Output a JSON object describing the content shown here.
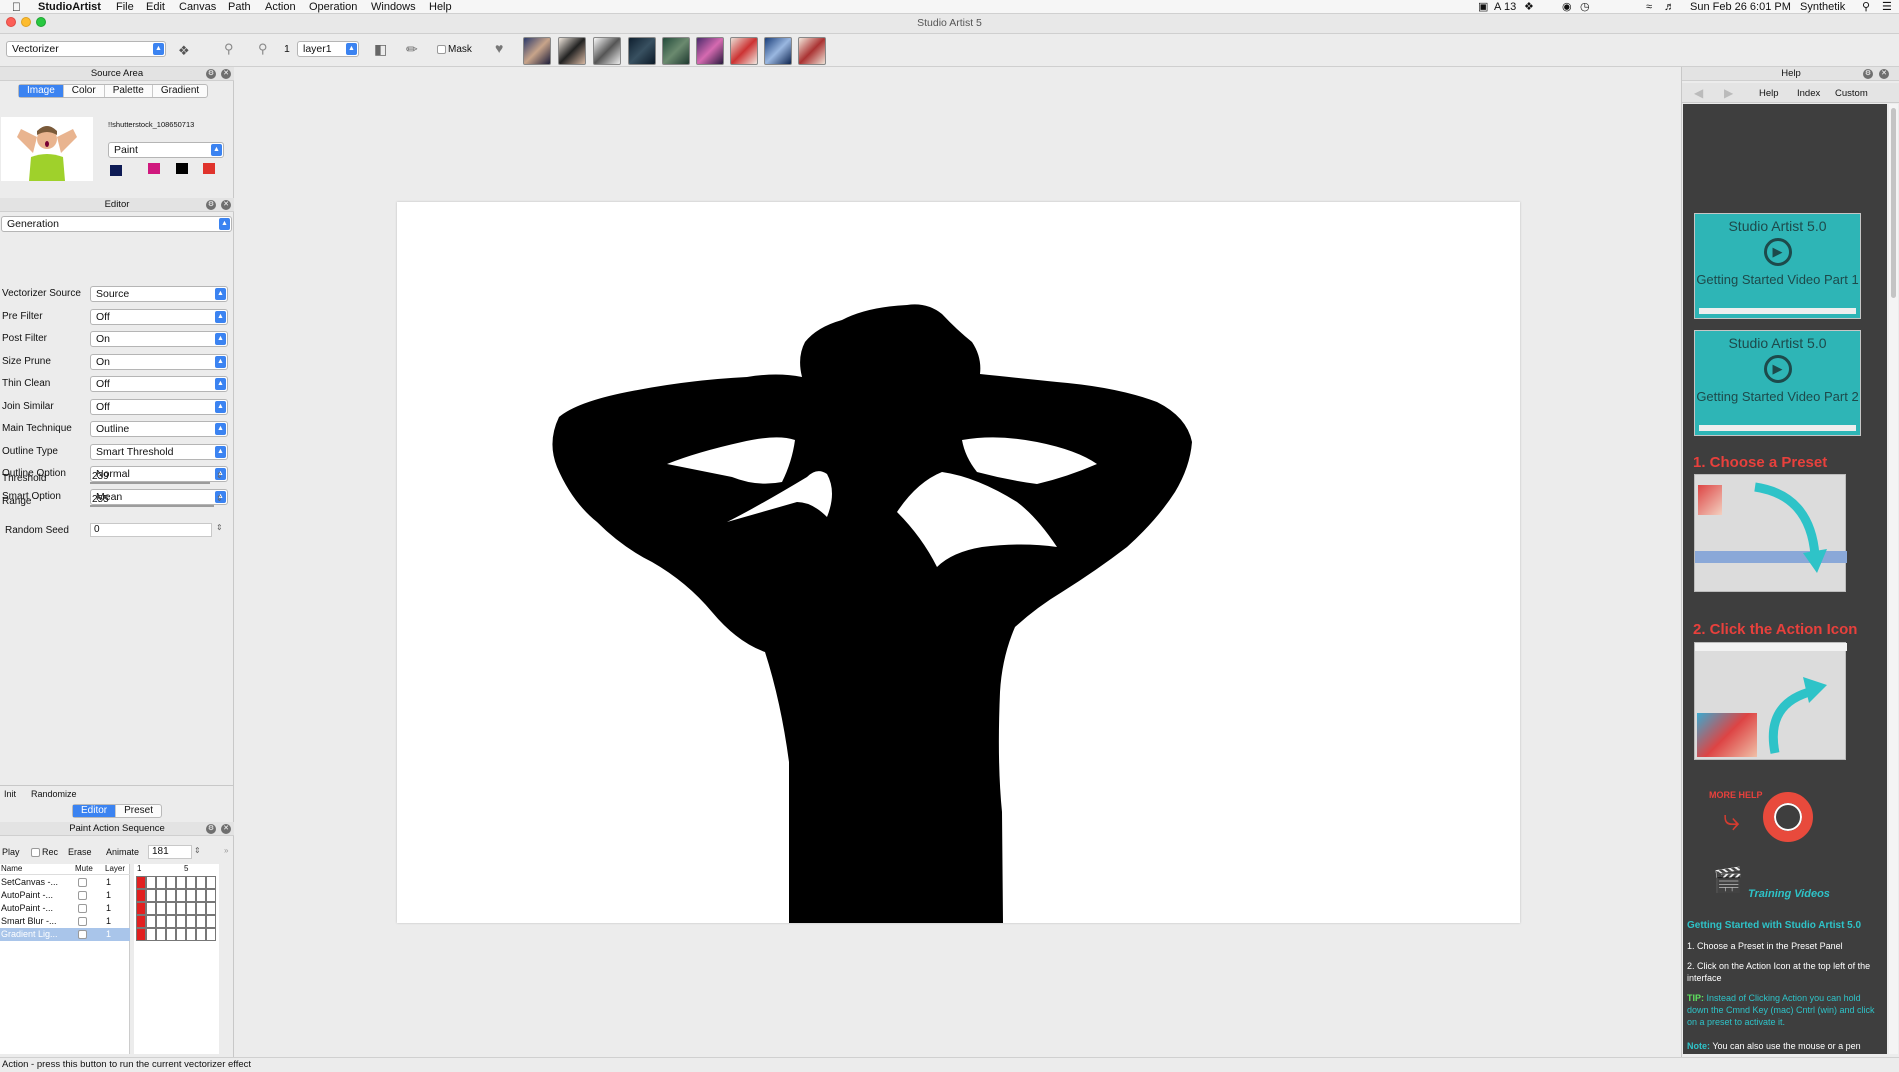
{
  "menubar": {
    "apple": "",
    "app": "StudioArtist",
    "items": [
      "File",
      "Edit",
      "Canvas",
      "Path",
      "Action",
      "Operation",
      "Windows",
      "Help"
    ],
    "right": {
      "adobe_count": "13",
      "datetime": "Sun Feb 26  6:01 PM",
      "user": "Synthetik"
    }
  },
  "window": {
    "title": "Studio Artist 5"
  },
  "toolbar": {
    "op_select": "Vectorizer",
    "layer_num": "1",
    "layer_select": "layer1",
    "mask_label": "Mask"
  },
  "source_area": {
    "title": "Source Area",
    "tabs": [
      "Image",
      "Color",
      "Palette",
      "Gradient"
    ],
    "filename": "!!shutterstock_108650713",
    "mode": "Paint",
    "swatches": [
      "#0e1b55",
      "#d0187e",
      "#000000",
      "#e0332c"
    ]
  },
  "editor": {
    "title": "Editor",
    "category": "Generation",
    "params": [
      {
        "label": "Vectorizer Source",
        "value": "Source"
      },
      {
        "label": "Pre Filter",
        "value": "Off"
      },
      {
        "label": "Post Filter",
        "value": "On"
      },
      {
        "label": "Size Prune",
        "value": "On"
      },
      {
        "label": "Thin Clean",
        "value": "Off"
      },
      {
        "label": "Join Similar",
        "value": "Off"
      },
      {
        "label": "Main Technique",
        "value": "Outline"
      },
      {
        "label": "Outline Type",
        "value": "Smart Threshold"
      },
      {
        "label": "Outline Option",
        "value": "Normal"
      },
      {
        "label": "Smart Option",
        "value": "Mean"
      }
    ],
    "threshold": {
      "label": "Threshold",
      "value": "239",
      "level": 0.94
    },
    "range": {
      "label": "Range",
      "value": "255",
      "level": 1.0
    },
    "seed": {
      "label": "Random Seed",
      "value": "0"
    },
    "init": "Init",
    "randomize": "Randomize",
    "tabs": [
      "Editor",
      "Preset"
    ]
  },
  "pas": {
    "title": "Paint Action Sequence",
    "play": "Play",
    "rec": "Rec",
    "erase": "Erase",
    "animate": "Animate",
    "frames": "181",
    "cols": {
      "name": "Name",
      "mute": "Mute",
      "layer": "Layer",
      "t1": "1",
      "t5": "5"
    },
    "rows": [
      {
        "name": "SetCanvas -...",
        "layer": "1"
      },
      {
        "name": "AutoPaint -...",
        "layer": "1"
      },
      {
        "name": "AutoPaint -...",
        "layer": "1"
      },
      {
        "name": "Smart Blur -...",
        "layer": "1"
      },
      {
        "name": "Gradient Lig...",
        "layer": "1"
      }
    ]
  },
  "status": {
    "text": "Action - press this button to run the current vectorizer effect"
  },
  "help": {
    "title": "Help",
    "nav": [
      "Help",
      "Index",
      "Custom"
    ],
    "video1": {
      "title": "Studio Artist 5.0",
      "sub": "Getting Started Video Part 1"
    },
    "video2": {
      "title": "Studio Artist 5.0",
      "sub": "Getting Started Video Part 2"
    },
    "step1": "1. Choose a Preset",
    "step2": "2. Click the Action Icon",
    "more_help": "MORE HELP",
    "training": "Training Videos",
    "heading": "Getting Started with Studio Artist 5.0",
    "p1": "1. Choose a Preset in the Preset Panel",
    "p2": "2. Click on the Action Icon at the top left of the interface",
    "tip_label": "TIP:",
    "tip": "Instead of Clicking Action you can hold down the Cmnd Key (mac) Cntrl (win) and click on a preset to activate it.",
    "note_label": "Note:",
    "note": "You can also use the mouse or a pen and tablet to manually paint or use assisted painting in the working canvas. There are Collections of Presets for Assisted Painting and Manual Painting in the Preset Panel"
  },
  "colors": {
    "accent": "#3b83f1",
    "teal": "#2eb5b6",
    "help_bg": "#3e3e3e",
    "step_red": "#e8403c"
  }
}
